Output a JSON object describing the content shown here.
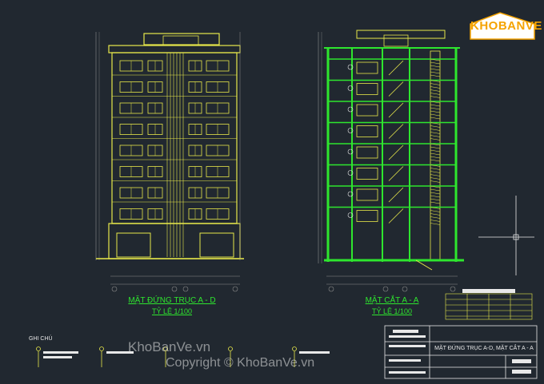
{
  "drawing": {
    "elevation_title": "MẶT ĐỨNG TRỤC A - D",
    "elevation_scale": "TỶ LỆ 1/100",
    "section_title": "MẶT CẮT A - A",
    "section_scale": "TỶ LỆ 1/100",
    "notes_heading": "GHI CHÚ",
    "sheet_title": "MẶT ĐỨNG TRỤC A-D, MẶT CẮT A - A"
  },
  "logo": {
    "text": "KHOBANVE",
    "accent_color": "#f5a300"
  },
  "watermark": {
    "line1": "KhoBanVe.vn",
    "line2": "Copyright © KhoBanVe.vn"
  },
  "colors": {
    "background": "#212830",
    "facade": "#e8e84a",
    "structure": "#2ee62e",
    "lines": "#e8e8e8"
  }
}
